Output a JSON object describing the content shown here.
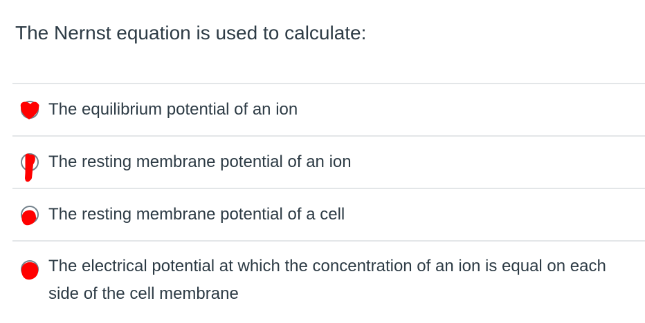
{
  "question": {
    "title": "The Nernst equation is used to calculate:",
    "answers": [
      {
        "label": "The equilibrium potential of an ion"
      },
      {
        "label": "The resting membrane potential of an ion"
      },
      {
        "label": "The resting membrane potential of a cell"
      },
      {
        "label": "The electrical potential at which the concentration of an ion is equal on each side of the cell membrane"
      }
    ]
  },
  "colors": {
    "text": "#2d3b45",
    "divider": "#e3e6e8",
    "radio_border": "#73818b",
    "scribble": "#ff0000"
  },
  "icons": {
    "answer_marker": "radio-circle-icon",
    "annotation": "red-scribble-mark-icon"
  }
}
